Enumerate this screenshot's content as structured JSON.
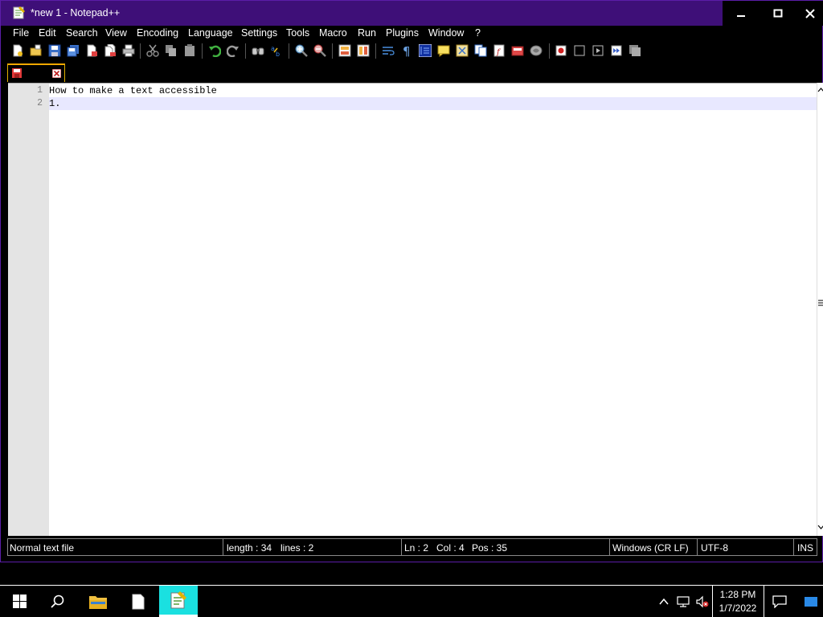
{
  "window": {
    "title": "*new 1 - Notepad++"
  },
  "menu": {
    "items": [
      "File",
      "Edit",
      "Search",
      "View",
      "Encoding",
      "Language",
      "Settings",
      "Tools",
      "Macro",
      "Run",
      "Plugins",
      "Window",
      "?"
    ]
  },
  "editor": {
    "lines": [
      {
        "number": "1",
        "text": "How to make a text accessible"
      },
      {
        "number": "2",
        "text": "1."
      }
    ]
  },
  "status": {
    "file_type": "Normal text file",
    "length": "length : 34",
    "lines": "lines : 2",
    "ln": "Ln : 2",
    "col": "Col : 4",
    "pos": "Pos : 35",
    "eol": "Windows (CR LF)",
    "encoding": "UTF-8",
    "mode": "INS"
  },
  "taskbar": {
    "time": "1:28 PM",
    "date": "1/7/2022"
  },
  "colors": {
    "titlebar": "#3e0f78",
    "frame": "#5b1da8",
    "tab_accent": "#f0a800",
    "active_task": "#1ae0e0"
  }
}
